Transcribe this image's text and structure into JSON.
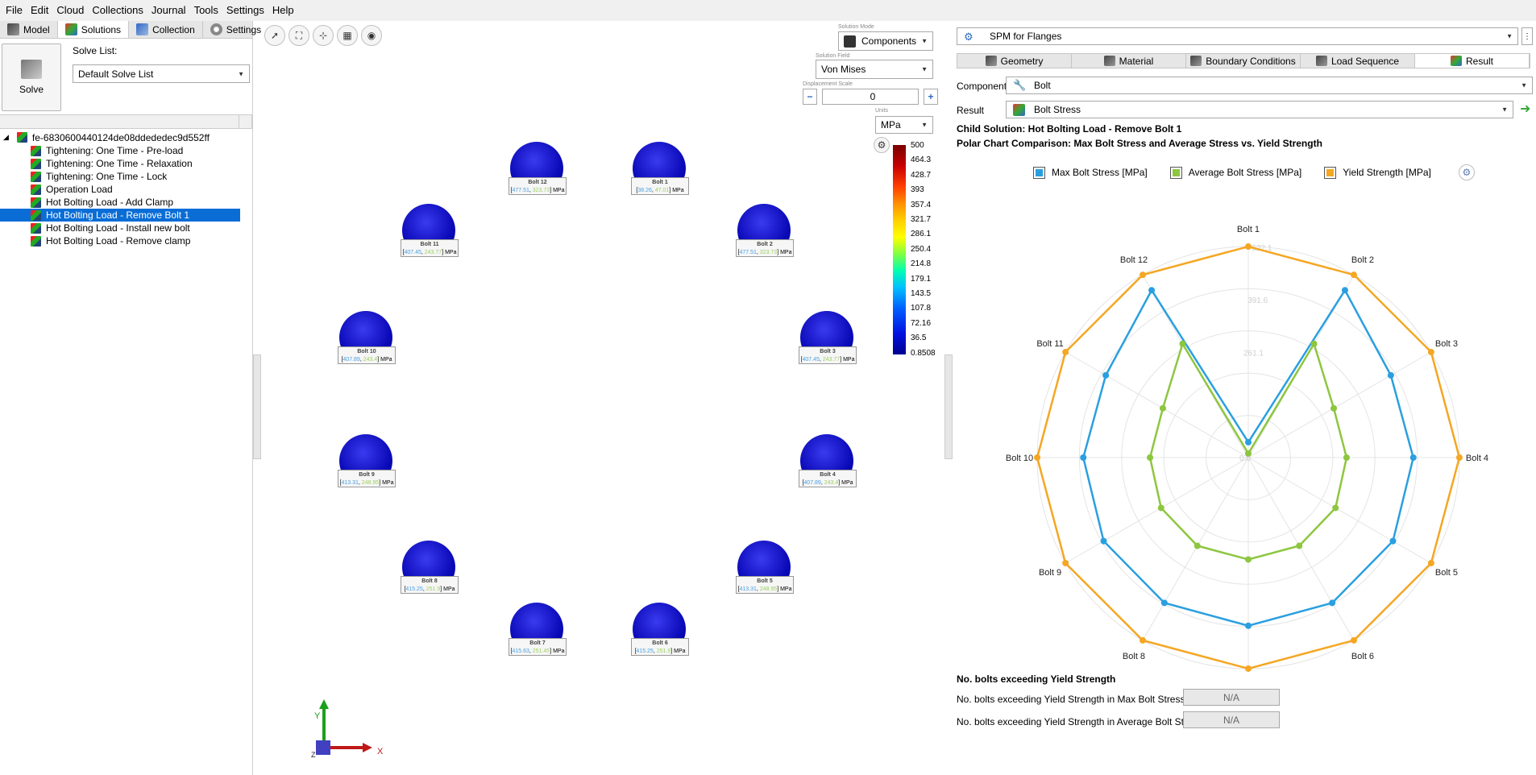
{
  "menu": [
    "File",
    "Edit",
    "Cloud",
    "Collections",
    "Journal",
    "Tools",
    "Settings",
    "Help"
  ],
  "left_tabs": [
    {
      "label": "Model",
      "icon": "model-icon"
    },
    {
      "label": "Solutions",
      "icon": "solutions-icon"
    },
    {
      "label": "Collection",
      "icon": "collection-icon"
    },
    {
      "label": "Settings",
      "icon": "settings-icon"
    }
  ],
  "solve": {
    "button_label": "Solve",
    "list_label": "Solve List:",
    "list_value": "Default Solve List"
  },
  "tree": {
    "root": "fe-6830600440124de08ddededec9d552ff",
    "items": [
      "Tightening: One Time - Pre-load",
      "Tightening: One Time - Relaxation",
      "Tightening: One Time - Lock",
      "Operation Load",
      "Hot Bolting Load - Add Clamp",
      "Hot Bolting Load - Remove Bolt 1",
      "Hot Bolting Load - Install new bolt",
      "Hot Bolting Load - Remove clamp"
    ],
    "selected_index": 5
  },
  "viewport": {
    "solution_mode_label": "Solution Mode",
    "solution_mode": "Components",
    "solution_field_label": "Solution Field",
    "solution_field": "Von Mises",
    "displacement_label": "Displacement Scale",
    "displacement_value": "0",
    "minus": "−",
    "plus": "+",
    "units_label": "Units",
    "units": "MPa",
    "legend_values": [
      "500",
      "464.3",
      "428.7",
      "393",
      "357.4",
      "321.7",
      "286.1",
      "250.4",
      "214.8",
      "179.1",
      "143.5",
      "107.8",
      "72.16",
      "36.5",
      "0.8508"
    ],
    "axis": {
      "x": "X",
      "y": "Y",
      "z": "Z"
    },
    "bolts": [
      {
        "name": "Bolt 12",
        "v1": "477.51",
        "v2": "323.73",
        "unit": "MPa"
      },
      {
        "name": "Bolt 1",
        "v1": "38.26",
        "v2": "47.01",
        "unit": "MPa"
      },
      {
        "name": "Bolt 11",
        "v1": "407.45",
        "v2": "243.77",
        "unit": "MPa"
      },
      {
        "name": "Bolt 2",
        "v1": "477.51",
        "v2": "323.73",
        "unit": "MPa"
      },
      {
        "name": "Bolt 10",
        "v1": "407.89",
        "v2": "243.4",
        "unit": "MPa"
      },
      {
        "name": "Bolt 3",
        "v1": "407.45",
        "v2": "243.77",
        "unit": "MPa"
      },
      {
        "name": "Bolt 9",
        "v1": "413.31",
        "v2": "248.95",
        "unit": "MPa"
      },
      {
        "name": "Bolt 4",
        "v1": "407.89",
        "v2": "243.4",
        "unit": "MPa"
      },
      {
        "name": "Bolt 8",
        "v1": "415.25",
        "v2": "251.9",
        "unit": "MPa"
      },
      {
        "name": "Bolt 5",
        "v1": "413.31",
        "v2": "248.95",
        "unit": "MPa"
      },
      {
        "name": "Bolt 7",
        "v1": "415.63",
        "v2": "251.45",
        "unit": "MPa"
      },
      {
        "name": "Bolt 6",
        "v1": "415.25",
        "v2": "251.9",
        "unit": "MPa"
      }
    ]
  },
  "right": {
    "app_select": "SPM for Flanges",
    "tabs": [
      "Geometry",
      "Material",
      "Boundary Conditions",
      "Load Sequence",
      "Result"
    ],
    "component_label": "Component",
    "component_value": "Bolt",
    "result_label": "Result",
    "result_value": "Bolt Stress",
    "child_solution": "Child Solution: Hot Bolting Load - Remove Bolt 1",
    "chart_title": "Polar Chart Comparison: Max Bolt Stress and Average Stress vs. Yield Strength",
    "exceed_heading": "No. bolts exceeding Yield Strength",
    "exceed_max_label": "No. bolts exceeding Yield Strength in Max Bolt Stress",
    "exceed_max_value": "N/A",
    "exceed_avg_label": "No. bolts exceeding Yield Strength in Average Bolt Stress",
    "exceed_avg_value": "N/A"
  },
  "chart_data": {
    "type": "radar",
    "title": "",
    "categories": [
      "Bolt 1",
      "Bolt 2",
      "Bolt 3",
      "Bolt 4",
      "Bolt 5",
      "Bolt 6",
      "Bolt 7",
      "Bolt 8",
      "Bolt 9",
      "Bolt 10",
      "Bolt 11",
      "Bolt 12"
    ],
    "radial_ticks": [
      "0.0",
      "261.1",
      "391.6",
      "522.1"
    ],
    "rmax": 522.1,
    "series": [
      {
        "name": "Max Bolt Stress [MPa]",
        "color": "#2a9fe0",
        "values": [
          38,
          478,
          407,
          408,
          413,
          415,
          416,
          415,
          413,
          408,
          407,
          478
        ]
      },
      {
        "name": "Average Bolt Stress [MPa]",
        "color": "#8dc63f",
        "values": [
          10,
          325,
          244,
          243,
          249,
          252,
          252,
          252,
          249,
          243,
          244,
          325
        ]
      },
      {
        "name": "Yield Strength [MPa]",
        "color": "#f5a623",
        "values": [
          522,
          522,
          522,
          522,
          522,
          522,
          522,
          522,
          522,
          522,
          522,
          522
        ]
      }
    ]
  }
}
